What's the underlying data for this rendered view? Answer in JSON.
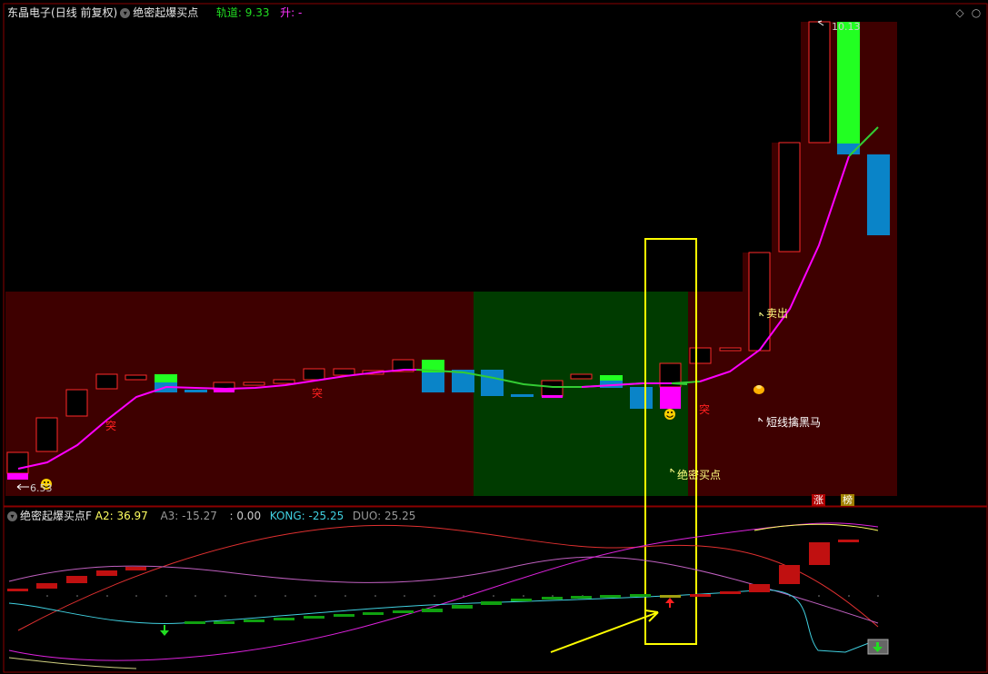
{
  "top_header": {
    "stock_name": "东晶电子",
    "period": "(日线 前复权)",
    "indicator_name": "绝密起爆买点",
    "track_label": "轨道",
    "track_value": "9.33",
    "rise_label": "升",
    "rise_value": "-"
  },
  "price_chart": {
    "high_marker": "10.13",
    "low_marker": "6.53",
    "sell_label": "卖出",
    "dark_horse_label": "短线擒黑马",
    "buy_point_label": "绝密买点",
    "breakout_char": "突",
    "limit_up_tag": "涨",
    "chart_tag": "榜",
    "colors": {
      "red_zone": "#3e0000",
      "green_zone": "#003b00",
      "candle_up_border": "#ff3030",
      "bar_magenta": "#ff00ff",
      "bar_green": "#22ff22",
      "bar_blue": "#0a84c8",
      "highlight": "#ffff00"
    }
  },
  "sub_header": {
    "indicator_name": "绝密起爆买点F",
    "a2_label": "A2",
    "a2_value": "36.97",
    "a3_label": "A3",
    "a3_value": "-15.27",
    "blank_label": "",
    "blank_value": "0.00",
    "kong_label": "KONG",
    "kong_value": "-25.25",
    "duo_label": "DUO",
    "duo_value": "25.25"
  }
}
